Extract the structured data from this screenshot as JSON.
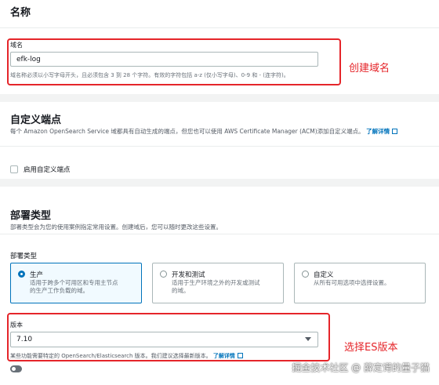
{
  "name_section": {
    "title": "名称",
    "field_label": "域名",
    "field_value": "efk-log",
    "hint": "域名称必须以小写字母开头，且必须包含 3 到 28 个字符。有效的字符包括 a-z (仅小写字母)、0-9 和 - (连字符)。"
  },
  "endpoint_section": {
    "title": "自定义端点",
    "description": "每个 Amazon OpenSearch Service 域都具有自动生成的端点，但您也可以使用 AWS Certificate Manager (ACM)添加自定义端点。",
    "learn_more": "了解详情",
    "checkbox_label": "启用自定义端点"
  },
  "deploy_section": {
    "title": "部署类型",
    "description": "部署类型会为您的使用案例指定常用设置。创建域后，您可以随时更改这些设置。",
    "sub_label": "部署类型",
    "options": [
      {
        "title": "生产",
        "desc1": "适用于跨多个可用区和专用主节点",
        "desc2": "的生产工作负载的域。"
      },
      {
        "title": "开发和测试",
        "desc1": "适用于生产环境之外的开发或测试",
        "desc2": "的域。"
      },
      {
        "title": "自定义",
        "desc1": "从所有可用选项中选择设置。",
        "desc2": ""
      }
    ],
    "selected": "生产"
  },
  "version_section": {
    "label": "版本",
    "value": "7.10",
    "hint": "某些功能需要特定的 OpenSearch/Elasticsearch 版本。我们建议选择最新版本。",
    "learn_more": "了解详情"
  },
  "annotations": {
    "create_domain": "创建域名",
    "choose_version": "选择ES版本"
  },
  "watermark": "掘金技术社区 @ 薛定谔的量子猫",
  "colors": {
    "annotation_red": "#e5252a",
    "link_blue": "#0073bb"
  }
}
